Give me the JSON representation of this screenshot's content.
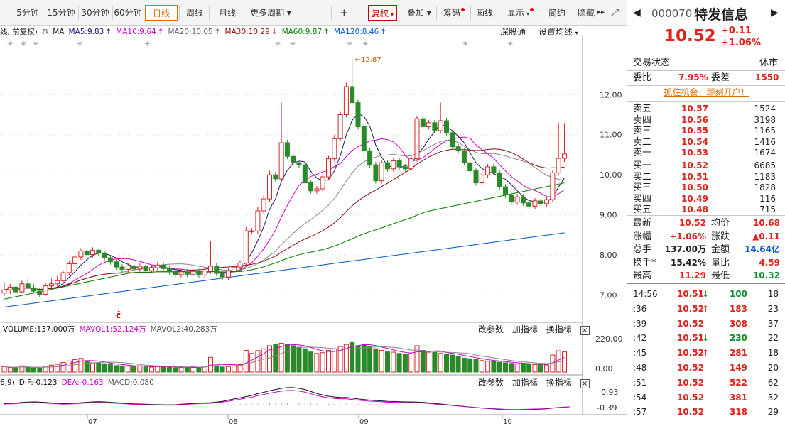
{
  "toolbar": {
    "items": [
      {
        "label": "5分钟",
        "active": false
      },
      {
        "label": "15分钟",
        "active": false
      },
      {
        "label": "30分钟",
        "active": false
      },
      {
        "label": "60分钟",
        "active": false
      },
      {
        "label": "日线",
        "active": true
      },
      {
        "label": "周线",
        "active": false
      },
      {
        "label": "月线",
        "active": false
      },
      {
        "label": "更多周期",
        "dropdown": true
      }
    ],
    "plus": "+",
    "minus": "—",
    "fuquan": "复权",
    "overlay": "叠加",
    "chips": "筹码",
    "draw": "画线",
    "display": "显示",
    "simple": "简约",
    "hide": "隐藏",
    "more_arrow": "▸▸"
  },
  "legend": {
    "prefix": "线, 前复权)",
    "ma_label": "MA",
    "ma": [
      {
        "name": "MA5",
        "value": "9.83",
        "color": "#1a1a66"
      },
      {
        "name": "MA10",
        "value": "9.64",
        "color": "#cc00cc"
      },
      {
        "name": "MA20",
        "value": "10.05",
        "color": "#666666"
      },
      {
        "name": "MA30",
        "value": "10.29",
        "color": "#8b1010"
      },
      {
        "name": "MA60",
        "value": "9.87",
        "color": "#008000"
      },
      {
        "name": "MA120",
        "value": "8.46",
        "color": "#0055cc"
      }
    ],
    "deep": "深股通",
    "set_ma": "设置均线"
  },
  "price_axis": [
    "12.00",
    "11.00",
    "10.00",
    "9.00",
    "8.00",
    "7.00"
  ],
  "max_label": "12.87",
  "volume": {
    "legend": [
      {
        "text": "VOLUME:137.000万",
        "color": "#111"
      },
      {
        "text": "MAVOL1:52.124万",
        "color": "#cc00cc"
      },
      {
        "text": "MAVOL2:40.283万",
        "color": "#555"
      }
    ],
    "axis": [
      "220.00",
      "0.00"
    ],
    "btns": [
      "改参数",
      "加指标",
      "换指标"
    ],
    "close": "×"
  },
  "macd": {
    "legend": [
      {
        "text": "6,9)",
        "color": "#111"
      },
      {
        "text": "DIF:-0.123",
        "color": "#111"
      },
      {
        "text": "DEA:-0.163",
        "color": "#cc00cc"
      },
      {
        "text": "MACD:0.080",
        "color": "#555"
      }
    ],
    "axis": [
      "0.93",
      "-0.39"
    ],
    "btns": [
      "改参数",
      "加指标",
      "换指标"
    ],
    "close": "×"
  },
  "date_axis": [
    "07",
    "08",
    "09",
    "10"
  ],
  "stock": {
    "code": "000070",
    "name": "特发信息",
    "price": "10.52",
    "change": "+0.11",
    "change_pct": "+1.06%",
    "status_label": "交易状态",
    "status_value": "休市",
    "weibi_label": "委比",
    "weibi_value": "7.95%",
    "weicha_label": "委差",
    "weicha_value": "1550",
    "promo": "抓住机会，即刻开户！"
  },
  "order_book": {
    "sell": [
      {
        "label": "卖五",
        "price": "10.57",
        "vol": "1524"
      },
      {
        "label": "卖四",
        "price": "10.56",
        "vol": "3198"
      },
      {
        "label": "卖三",
        "price": "10.55",
        "vol": "1165"
      },
      {
        "label": "卖二",
        "price": "10.54",
        "vol": "1416"
      },
      {
        "label": "卖一",
        "price": "10.53",
        "vol": "1674"
      }
    ],
    "buy": [
      {
        "label": "买一",
        "price": "10.52",
        "vol": "6685"
      },
      {
        "label": "买二",
        "price": "10.51",
        "vol": "1183"
      },
      {
        "label": "买三",
        "price": "10.50",
        "vol": "1828"
      },
      {
        "label": "买四",
        "price": "10.49",
        "vol": "116"
      },
      {
        "label": "买五",
        "price": "10.48",
        "vol": "715"
      }
    ]
  },
  "stats": [
    {
      "l1": "最新",
      "v1": "10.52",
      "c1": "red",
      "l2": "均价",
      "v2": "10.68",
      "c2": "red"
    },
    {
      "l1": "涨幅",
      "v1": "+1.06%",
      "c1": "red",
      "l2": "涨跌",
      "v2": "▲0.11",
      "c2": "red"
    },
    {
      "l1": "总手",
      "v1": "137.00万",
      "c1": "",
      "l2": "金额",
      "v2": "14.64亿",
      "c2": "blue"
    },
    {
      "l1": "换手*",
      "v1": "15.42%",
      "c1": "",
      "l2": "量比",
      "v2": "4.59",
      "c2": "red"
    },
    {
      "l1": "最高",
      "v1": "11.29",
      "c1": "red",
      "l2": "最低",
      "v2": "10.32",
      "c2": "green"
    }
  ],
  "ticks": [
    {
      "time": "14:56",
      "price": "10.51",
      "arrow": "↓",
      "dir": "down",
      "vol": "100",
      "n": "18"
    },
    {
      "time": ":36",
      "price": "10.52",
      "arrow": "↑",
      "dir": "up",
      "vol": "183",
      "n": "23"
    },
    {
      "time": ":39",
      "price": "10.52",
      "arrow": "",
      "dir": "flat",
      "vol": "308",
      "n": "37"
    },
    {
      "time": ":42",
      "price": "10.51",
      "arrow": "↓",
      "dir": "down",
      "vol": "230",
      "n": "22"
    },
    {
      "time": ":45",
      "price": "10.52",
      "arrow": "↑",
      "dir": "up",
      "vol": "281",
      "n": "18"
    },
    {
      "time": ":48",
      "price": "10.52",
      "arrow": "",
      "dir": "flat",
      "vol": "149",
      "n": "20"
    },
    {
      "time": ":51",
      "price": "10.52",
      "arrow": "",
      "dir": "flat",
      "vol": "522",
      "n": "62"
    },
    {
      "time": ":54",
      "price": "10.52",
      "arrow": "",
      "dir": "flat",
      "vol": "381",
      "n": "32"
    },
    {
      "time": ":57",
      "price": "10.52",
      "arrow": "",
      "dir": "flat",
      "vol": "318",
      "n": "29"
    }
  ],
  "chart_data": {
    "type": "candlestick",
    "price_range": [
      6.55,
      13.05
    ],
    "candles": [
      [
        7.05,
        7.13,
        7.32,
        6.98
      ],
      [
        7.13,
        7.2,
        7.28,
        7.03
      ],
      [
        7.2,
        7.08,
        7.31,
        7.02
      ],
      [
        7.08,
        7.28,
        7.36,
        7.04
      ],
      [
        7.28,
        7.18,
        7.4,
        7.12
      ],
      [
        7.18,
        7.1,
        7.27,
        7.04
      ],
      [
        7.1,
        7.02,
        7.18,
        6.95
      ],
      [
        7.02,
        7.23,
        7.3,
        6.98
      ],
      [
        7.23,
        7.28,
        7.41,
        7.15
      ],
      [
        7.28,
        7.36,
        7.48,
        7.21
      ],
      [
        7.36,
        7.56,
        7.6,
        7.3
      ],
      [
        7.56,
        7.78,
        7.85,
        7.49
      ],
      [
        7.78,
        7.95,
        8.03,
        7.7
      ],
      [
        7.95,
        8.1,
        8.17,
        7.88
      ],
      [
        8.1,
        8.01,
        8.16,
        7.93
      ],
      [
        8.01,
        8.12,
        8.19,
        7.94
      ],
      [
        8.12,
        8.05,
        8.16,
        7.98
      ],
      [
        8.05,
        7.93,
        8.11,
        7.86
      ],
      [
        7.93,
        7.83,
        8.0,
        7.76
      ],
      [
        7.83,
        7.7,
        7.9,
        7.63
      ],
      [
        7.7,
        7.64,
        7.77,
        7.57
      ],
      [
        7.64,
        7.73,
        7.8,
        7.57
      ],
      [
        7.73,
        7.65,
        7.79,
        7.58
      ],
      [
        7.65,
        7.72,
        7.79,
        7.58
      ],
      [
        7.72,
        7.61,
        7.79,
        7.54
      ],
      [
        7.61,
        7.68,
        7.75,
        7.54
      ],
      [
        7.68,
        7.75,
        7.82,
        7.61
      ],
      [
        7.75,
        7.66,
        7.82,
        7.59
      ],
      [
        7.66,
        7.58,
        7.73,
        7.51
      ],
      [
        7.58,
        7.51,
        7.65,
        7.44
      ],
      [
        7.51,
        7.58,
        7.65,
        7.44
      ],
      [
        7.58,
        7.52,
        7.65,
        7.45
      ],
      [
        7.52,
        7.59,
        7.66,
        7.45
      ],
      [
        7.59,
        7.5,
        7.66,
        7.43
      ],
      [
        7.5,
        7.6,
        7.67,
        7.43
      ],
      [
        7.6,
        7.72,
        8.35,
        7.53
      ],
      [
        7.72,
        7.54,
        7.79,
        7.47
      ],
      [
        7.54,
        7.45,
        7.61,
        7.38
      ],
      [
        7.45,
        7.6,
        7.67,
        7.38
      ],
      [
        7.6,
        7.7,
        7.77,
        7.53
      ],
      [
        7.7,
        7.8,
        7.87,
        7.63
      ],
      [
        7.8,
        8.6,
        8.7,
        7.73
      ],
      [
        8.6,
        8.6,
        8.67,
        8.53
      ],
      [
        8.6,
        9.1,
        9.2,
        8.53
      ],
      [
        9.1,
        9.4,
        9.5,
        9.03
      ],
      [
        9.4,
        10.0,
        10.1,
        9.33
      ],
      [
        10.0,
        9.9,
        10.07,
        9.83
      ],
      [
        9.9,
        10.8,
        11.8,
        9.83
      ],
      [
        10.8,
        10.46,
        10.87,
        10.39
      ],
      [
        10.46,
        10.3,
        10.53,
        10.23
      ],
      [
        10.3,
        10.25,
        10.32,
        10.18
      ],
      [
        10.25,
        9.8,
        10.32,
        9.73
      ],
      [
        9.8,
        9.6,
        9.87,
        9.53
      ],
      [
        9.6,
        9.65,
        9.72,
        9.53
      ],
      [
        9.65,
        9.95,
        10.02,
        9.58
      ],
      [
        9.95,
        10.4,
        10.47,
        9.88
      ],
      [
        10.4,
        10.9,
        11.0,
        10.33
      ],
      [
        10.9,
        11.5,
        11.57,
        10.83
      ],
      [
        11.5,
        12.2,
        12.3,
        11.43
      ],
      [
        12.2,
        11.8,
        12.87,
        11.73
      ],
      [
        11.8,
        11.2,
        11.87,
        11.13
      ],
      [
        11.2,
        10.6,
        11.27,
        10.53
      ],
      [
        10.6,
        10.25,
        10.67,
        10.18
      ],
      [
        10.25,
        9.85,
        10.32,
        9.78
      ],
      [
        9.85,
        10.3,
        10.37,
        9.78
      ],
      [
        10.3,
        10.15,
        10.37,
        10.08
      ],
      [
        10.15,
        10.35,
        10.42,
        10.08
      ],
      [
        10.35,
        10.2,
        10.42,
        10.13
      ],
      [
        10.2,
        10.15,
        10.27,
        10.08
      ],
      [
        10.15,
        10.4,
        10.47,
        10.08
      ],
      [
        10.4,
        11.4,
        11.47,
        10.33
      ],
      [
        11.4,
        11.2,
        11.47,
        11.13
      ],
      [
        11.2,
        11.3,
        11.37,
        11.13
      ],
      [
        11.3,
        11.1,
        11.37,
        11.03
      ],
      [
        11.1,
        11.35,
        11.8,
        11.03
      ],
      [
        11.35,
        11.05,
        11.42,
        10.98
      ],
      [
        11.05,
        10.7,
        11.12,
        10.63
      ],
      [
        10.7,
        10.6,
        10.77,
        10.53
      ],
      [
        10.6,
        10.3,
        10.67,
        10.23
      ],
      [
        10.3,
        10.1,
        10.37,
        10.03
      ],
      [
        10.1,
        9.8,
        10.17,
        9.73
      ],
      [
        9.8,
        10.0,
        10.07,
        9.73
      ],
      [
        10.0,
        10.2,
        10.27,
        9.93
      ],
      [
        10.2,
        10.05,
        10.27,
        9.98
      ],
      [
        10.05,
        9.7,
        10.12,
        9.63
      ],
      [
        9.7,
        9.5,
        9.77,
        9.43
      ],
      [
        9.5,
        9.32,
        9.57,
        9.25
      ],
      [
        9.32,
        9.45,
        9.52,
        9.25
      ],
      [
        9.45,
        9.3,
        9.52,
        9.23
      ],
      [
        9.3,
        9.22,
        9.37,
        9.15
      ],
      [
        9.22,
        9.35,
        9.42,
        9.15
      ],
      [
        9.35,
        9.28,
        9.42,
        9.21
      ],
      [
        9.28,
        9.38,
        9.45,
        9.21
      ],
      [
        9.38,
        10.05,
        10.12,
        9.31
      ],
      [
        10.05,
        10.41,
        11.3,
        9.98
      ],
      [
        10.41,
        10.52,
        11.29,
        10.32
      ]
    ],
    "volumes": [
      35,
      28,
      30,
      40,
      32,
      26,
      24,
      38,
      45,
      50,
      62,
      72,
      80,
      88,
      70,
      60,
      58,
      54,
      48,
      42,
      40,
      38,
      36,
      40,
      34,
      32,
      36,
      38,
      30,
      28,
      30,
      28,
      34,
      30,
      38,
      95,
      40,
      32,
      36,
      40,
      48,
      140,
      120,
      138,
      150,
      170,
      178,
      186,
      180,
      170,
      160,
      150,
      130,
      120,
      125,
      140,
      150,
      165,
      178,
      190,
      170,
      180,
      165,
      150,
      140,
      130,
      128,
      120,
      115,
      118,
      170,
      140,
      128,
      126,
      120,
      116,
      110,
      100,
      90,
      86,
      80,
      74,
      70,
      68,
      64,
      60,
      56,
      52,
      55,
      50,
      48,
      47,
      46,
      110,
      137,
      130
    ],
    "macd_values": [
      0.05,
      0.06,
      0.07,
      0.1,
      0.12,
      0.13,
      0.12,
      0.1,
      0.08,
      0.06,
      0.04,
      0.05,
      0.07,
      0.09,
      0.11,
      0.13,
      0.14,
      0.13,
      0.11,
      0.09,
      0.07,
      0.05,
      0.03,
      0.02,
      0.01,
      0.0,
      -0.01,
      -0.02,
      -0.02,
      -0.02,
      0.01,
      0.03,
      0.05,
      0.07,
      0.08,
      0.09,
      0.12,
      0.16,
      0.22,
      0.28,
      0.34,
      0.4,
      0.46,
      0.55,
      0.62,
      0.7,
      0.76,
      0.82,
      0.86,
      0.86,
      0.82,
      0.76,
      0.66,
      0.56,
      0.48,
      0.42,
      0.38,
      0.36,
      0.36,
      0.32,
      0.28,
      0.25,
      0.22,
      0.2,
      0.18,
      0.16,
      0.15,
      0.14,
      0.13,
      0.13,
      0.12,
      0.11,
      0.08,
      0.05,
      0.02,
      -0.01,
      -0.04,
      -0.07,
      -0.1,
      -0.13,
      -0.16,
      -0.19,
      -0.21,
      -0.23,
      -0.25,
      -0.27,
      -0.28,
      -0.28,
      -0.27,
      -0.26,
      -0.25,
      -0.24,
      -0.22,
      -0.19,
      -0.16,
      -0.14,
      -0.12
    ],
    "macd_ylim": [
      -0.45,
      1.0
    ]
  }
}
